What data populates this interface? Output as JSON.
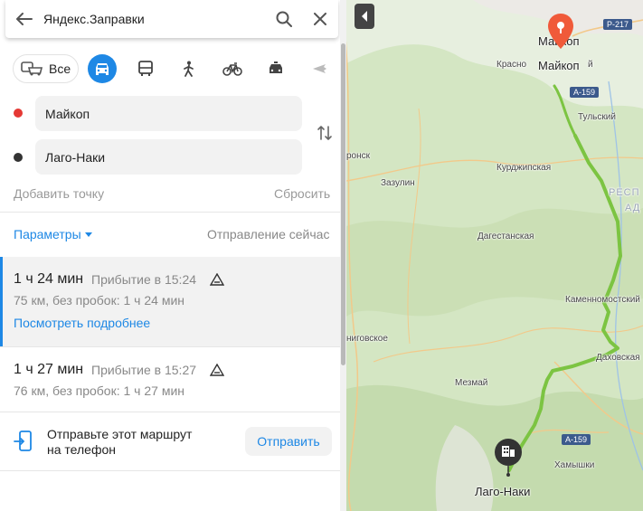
{
  "search": {
    "title": "Яндекс.Заправки"
  },
  "modes": {
    "all_label": "Все"
  },
  "waypoints": {
    "from": {
      "value": "Майкоп",
      "color": "#e53935"
    },
    "to": {
      "value": "Лаго-Наки",
      "color": "#333333"
    },
    "add_point": "Добавить точку",
    "reset": "Сбросить"
  },
  "options": {
    "params_label": "Параметры",
    "departure": "Отправление сейчас"
  },
  "routes": [
    {
      "duration": "1 ч 24 мин",
      "arrival": "Прибытие в 15:24",
      "details": "75 км, без пробок: 1 ч 24 мин",
      "more_link": "Посмотреть подробнее",
      "selected": true
    },
    {
      "duration": "1 ч 27 мин",
      "arrival": "Прибытие в 15:27",
      "details": "76 км, без пробок: 1 ч 27 мин",
      "selected": false
    }
  ],
  "send": {
    "text_line1": "Отправьте этот маршрут",
    "text_line2": "на телефон",
    "button": "Отправить"
  },
  "map": {
    "labels": {
      "maikop_top": "Майкоп",
      "maikop_pin": "Майкоп",
      "krasnoo": "Красно",
      "tulsky": "Тульский",
      "ronsk": "ронск",
      "kurdzhipskaya": "Курджипская",
      "zazulin": "Зазулин",
      "resp": "РЕСП",
      "ad": "АД",
      "dagestanskaya": "Дагестанская",
      "kamennomostsky": "Каменномостский",
      "nigovskoe": "ниговское",
      "dakhovskaya": "Даховская",
      "mezmay": "Мезмай",
      "khamyshki": "Хамышки",
      "lago_naki": "Лаго-Наки",
      "i_short": "й"
    },
    "roads": {
      "p217": "Р-217",
      "a159_top": "А-159",
      "a159_bottom": "А-159"
    },
    "route_color": "#7cc442"
  }
}
